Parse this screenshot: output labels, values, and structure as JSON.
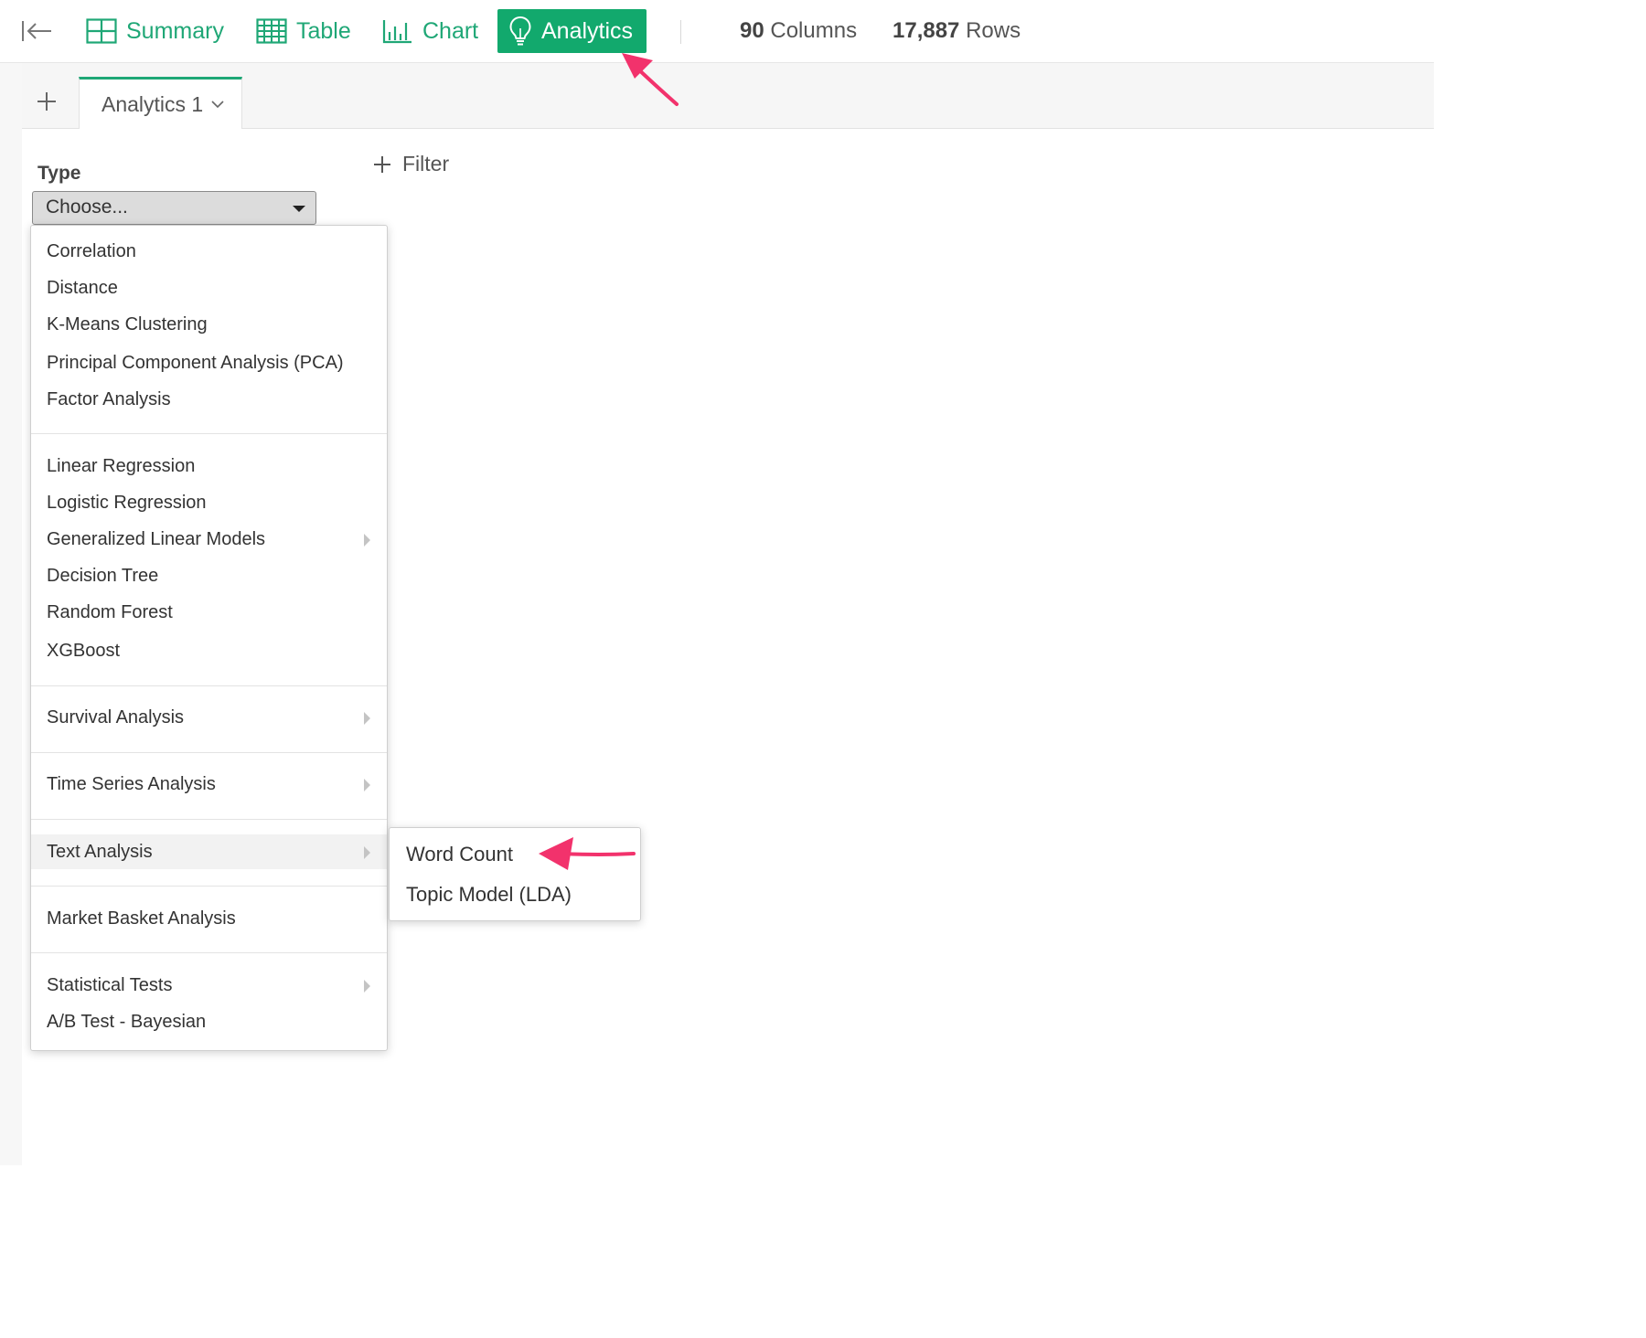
{
  "toolbar": {
    "tabs": [
      {
        "label": "Summary",
        "icon": "summary-grid-icon"
      },
      {
        "label": "Table",
        "icon": "table-icon"
      },
      {
        "label": "Chart",
        "icon": "bar-chart-icon"
      },
      {
        "label": "Analytics",
        "icon": "lightbulb-icon",
        "active": true
      }
    ],
    "columns_count": "90",
    "columns_label": "Columns",
    "rows_count": "17,887",
    "rows_label": "Rows"
  },
  "tabbar": {
    "tabs": [
      {
        "label": "Analytics 1"
      }
    ]
  },
  "type_panel": {
    "label": "Type",
    "select_value": "Choose...",
    "filter_label": "Filter"
  },
  "menu": {
    "items": [
      "Correlation",
      "Distance",
      "K-Means Clustering",
      "Principal Component Analysis (PCA)",
      "Factor Analysis",
      "Linear Regression",
      "Logistic Regression",
      "Generalized Linear Models",
      "Decision Tree",
      "Random Forest",
      "XGBoost",
      "Survival Analysis",
      "Time Series Analysis",
      "Text Analysis",
      "Market Basket Analysis",
      "Statistical Tests",
      "A/B Test - Bayesian"
    ],
    "highlighted": "Text Analysis"
  },
  "submenu": {
    "items": [
      "Word Count",
      "Topic Model (LDA)"
    ]
  },
  "colors": {
    "accent": "#12a96d",
    "nav_text": "#1fa776",
    "annotation_arrow": "#f2326c"
  }
}
